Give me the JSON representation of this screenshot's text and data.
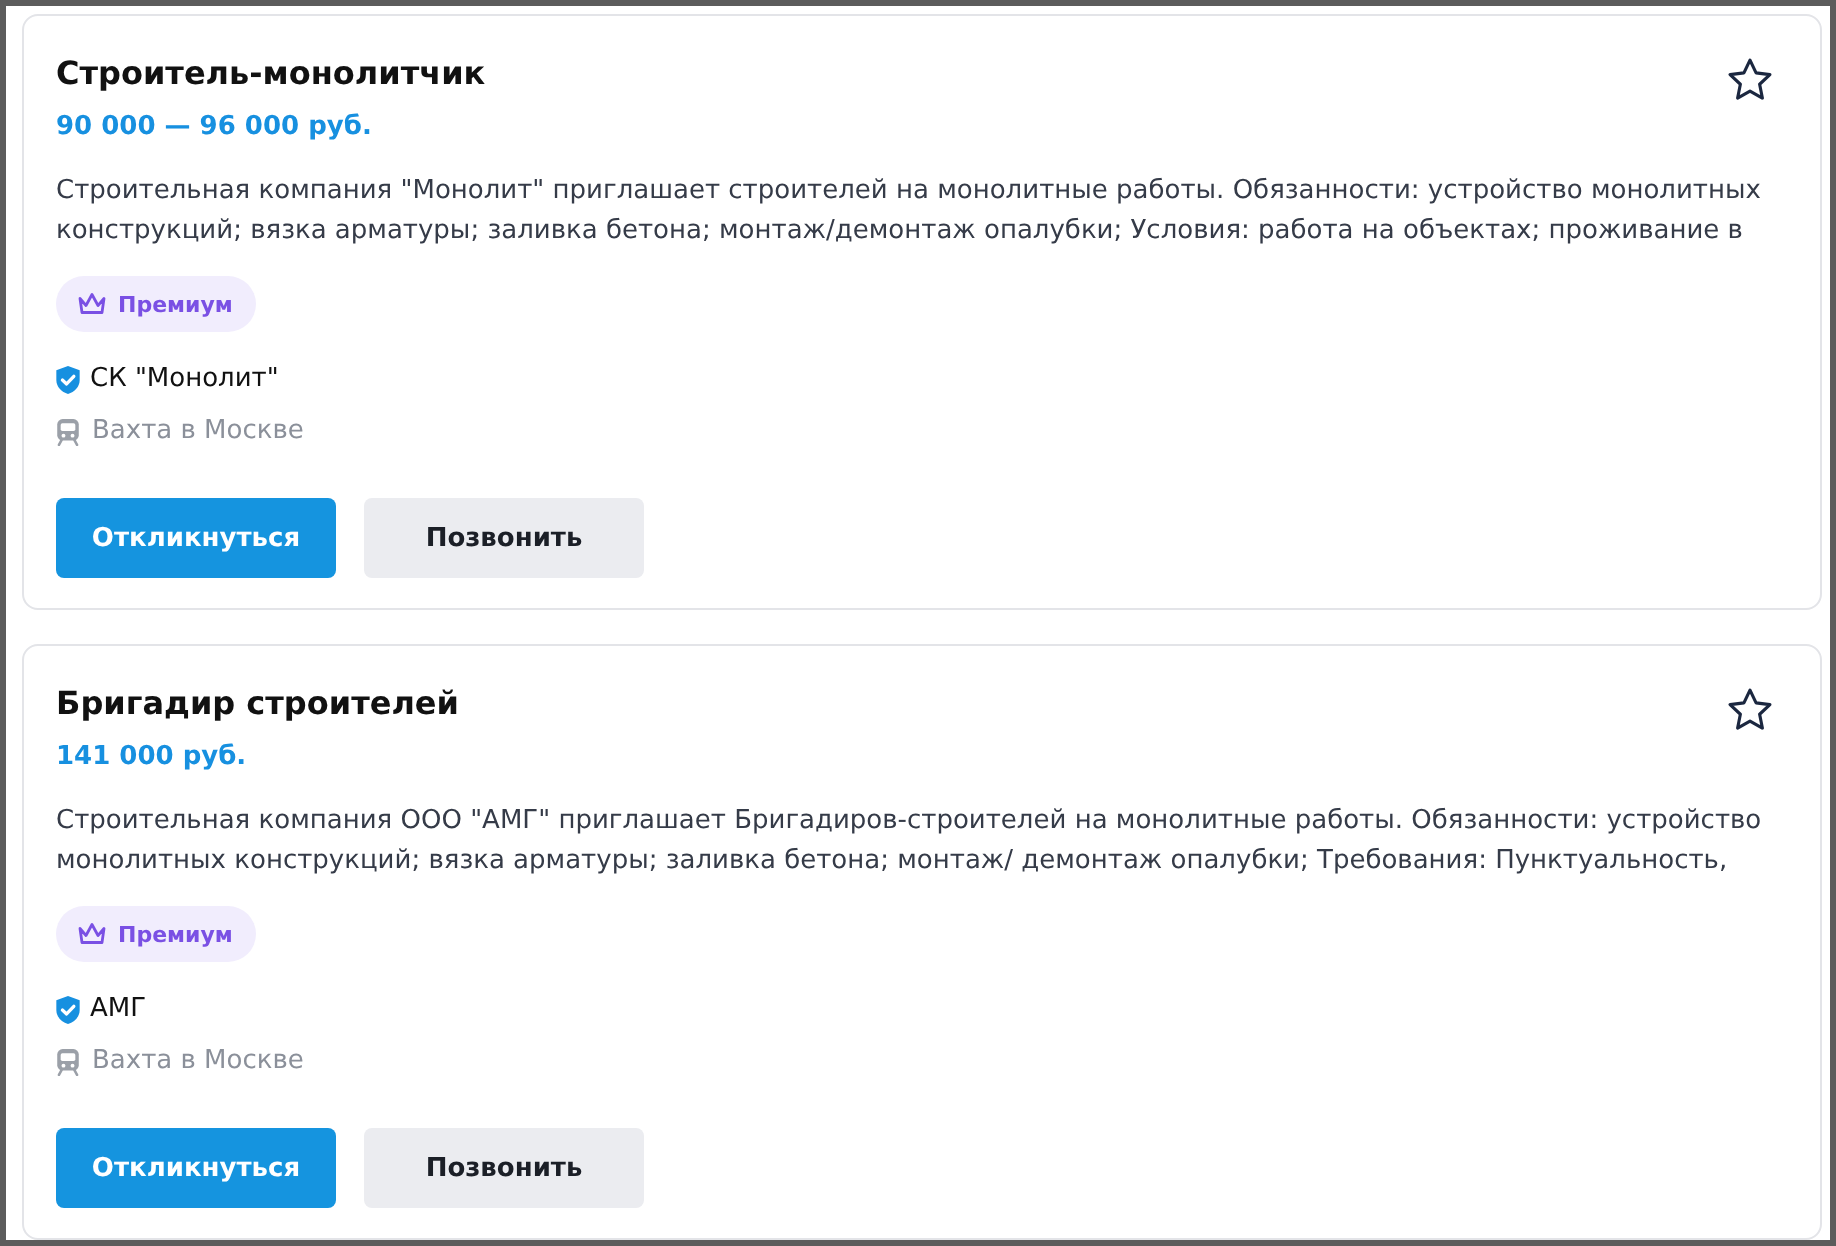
{
  "vacancies": [
    {
      "title": "Строитель-монолитчик",
      "salary": "90 000 — 96 000 руб.",
      "favorite": false,
      "description": "Строительная компания \"Монолит\" приглашает строителей на монолитные работы. Обязанности: устройство монолитных конструкций; вязка арматуры; заливка бетона; монтаж/демонтаж опалубки; Условия: работа на объектах; проживание в",
      "badge": "Премиум",
      "company": {
        "name": "СК \"Монолит\"",
        "verified": true
      },
      "location": "Вахта в Москве",
      "buttons": [
        {
          "label": "Откликнуться",
          "kind": "primary"
        },
        {
          "label": "Позвонить",
          "kind": "secondary"
        }
      ]
    },
    {
      "title": "Бригадир строителей",
      "salary": "141 000 руб.",
      "favorite": false,
      "description": "Строительная компания ООО \"АМГ\" приглашает Бригадиров-строителей на монолитные работы. Обязанности: устройство монолитных конструкций; вязка арматуры; заливка бетона; монтаж/ демонтаж опалубки; Требования: Пунктуальность,",
      "badge": "Премиум",
      "company": {
        "name": "АМГ",
        "verified": true
      },
      "location": "Вахта в Москве",
      "buttons": [
        {
          "label": "Откликнуться",
          "kind": "primary"
        },
        {
          "label": "Позвонить",
          "kind": "secondary"
        }
      ]
    }
  ]
}
